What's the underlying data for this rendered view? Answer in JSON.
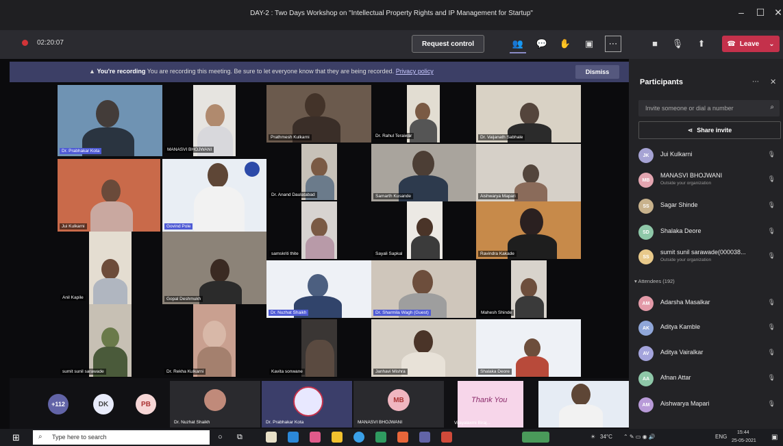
{
  "window": {
    "title": "DAY-2 : Two Days Workshop on \"Intellectual Property Rights and IP Management for Startup\""
  },
  "toolbar": {
    "timer": "02:20:07",
    "request_control": "Request control",
    "leave": "Leave"
  },
  "banner": {
    "heading": "You're recording",
    "text": "You are recording this meeting. Be sure to let everyone know that they are being recorded.",
    "privacy": "Privacy policy",
    "dismiss": "Dismiss"
  },
  "tiles": [
    "Dr. Prabhakar Kota",
    "MANASVI BHOJWANI",
    "Prathmesh Kulkarni",
    "Dr. Rahul Teraiwar",
    "Dr. Vaijanath Sabhale",
    "Jui Kulkarni",
    "Govind Pole",
    "Dr. Anand Daulatabad",
    "Samarth Kusande",
    "Aishwarya Mapari",
    "samskriti thite",
    "Sayali Sapkal",
    "Ravindra Kakade",
    "Anil Kapile",
    "Gopal Deshmukh",
    "Dr. Nuzhat Shaikh",
    "Dr. Sharmila Wagh (Guest)",
    "Mahesh Shinde",
    "sumit sunil sarawade",
    "Dr. Rekha Kulkarni",
    "Kavita sonwane",
    "Janhavi Mishra",
    "Shalaka Deore"
  ],
  "stage": {
    "overflow": "+112",
    "avatars": [
      "DK",
      "PB"
    ],
    "featured": [
      "Dr. Nuzhat Shaikh",
      "Dr. Prabhakar Kota",
      "MANASVI BHOJWANI",
      "Vijayalaxmi Biraj..."
    ],
    "mb": "MB",
    "card": "Thank You"
  },
  "participants": {
    "title": "Participants",
    "invite_placeholder": "Invite someone or dial a number",
    "share_invite": "Share invite",
    "list": [
      {
        "initials": "JK",
        "name": "Jui Kulkarni",
        "sub": ""
      },
      {
        "initials": "MB",
        "name": "MANASVI BHOJWANI",
        "sub": "Outside your organization"
      },
      {
        "initials": "SS",
        "name": "Sagar Shinde",
        "sub": ""
      },
      {
        "initials": "SD",
        "name": "Shalaka Deore",
        "sub": ""
      },
      {
        "initials": "SS",
        "name": "sumit sunil sarawade(000038...",
        "sub": "Outside your organization"
      }
    ],
    "attendees_header": "Attendees (192)",
    "attendees": [
      {
        "initials": "AM",
        "name": "Adarsha Masalkar"
      },
      {
        "initials": "AK",
        "name": "Aditya Kamble"
      },
      {
        "initials": "AV",
        "name": "Aditya Vairalkar"
      },
      {
        "initials": "AA",
        "name": "Afnan Attar"
      },
      {
        "initials": "AM",
        "name": "Aishwarya Mapari"
      }
    ]
  },
  "taskbar": {
    "search": "Type here to search",
    "temp": "34°C",
    "lang": "ENG",
    "time": "15:44",
    "date": "25-05-2021"
  },
  "colors": {
    "accent": "#6264a7",
    "leave": "#c4314b",
    "recording": "#d13438"
  }
}
